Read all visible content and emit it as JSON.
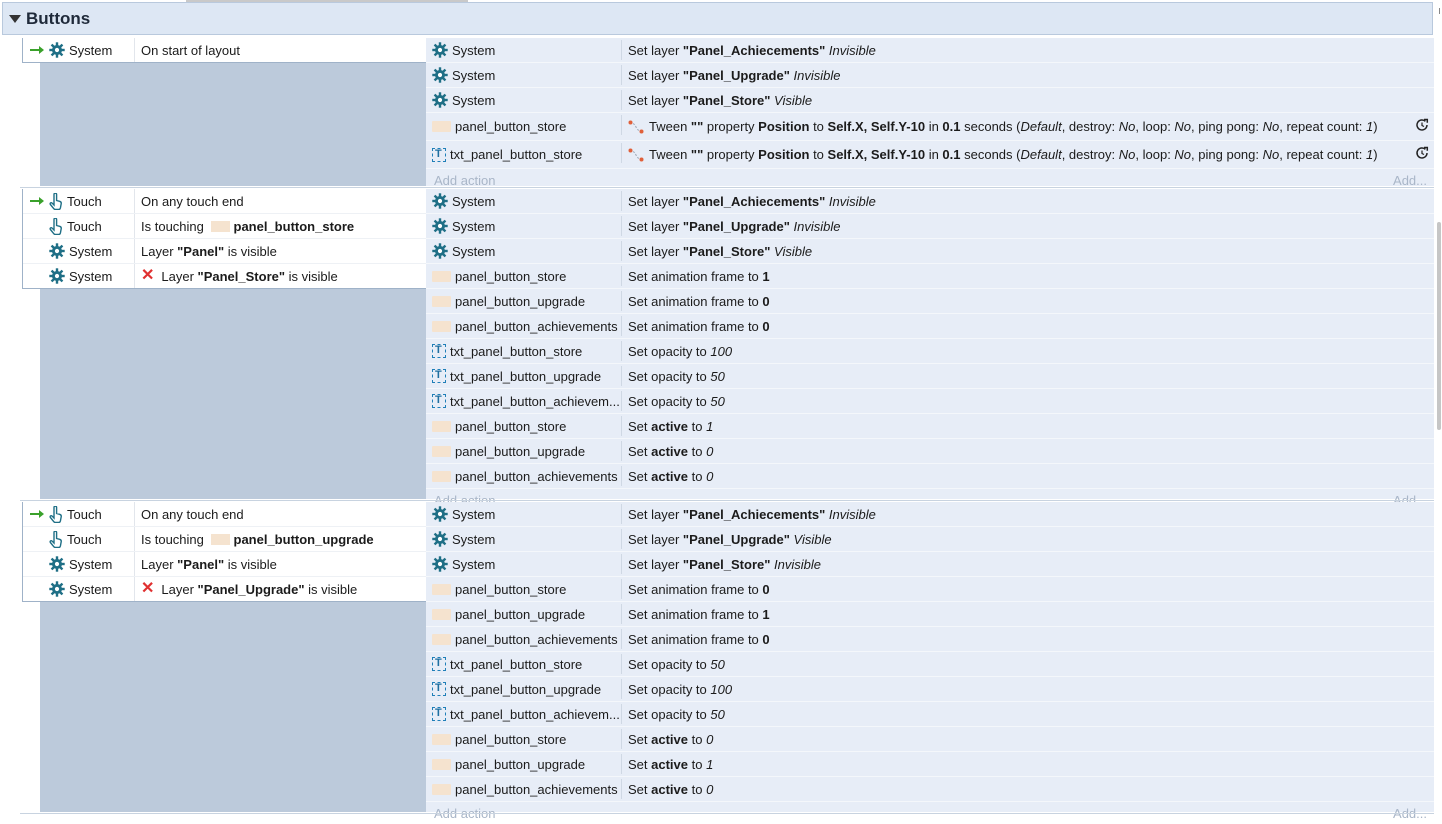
{
  "group": {
    "title": "Buttons"
  },
  "events": [
    {
      "conditions": [
        {
          "trigger": true,
          "icon": "gear-icon",
          "object": "System",
          "invert": false,
          "parts": [
            {
              "t": "On start of layout",
              "s": "n"
            }
          ]
        }
      ],
      "actions": [
        {
          "icon": "gear-icon",
          "object": "System",
          "parts": [
            {
              "t": "Set layer ",
              "s": "n"
            },
            {
              "t": "\"Panel_Achiecements\"",
              "s": "b"
            },
            {
              "t": " Invisible",
              "s": "i"
            }
          ]
        },
        {
          "icon": "gear-icon",
          "object": "System",
          "parts": [
            {
              "t": "Set layer ",
              "s": "n"
            },
            {
              "t": "\"Panel_Upgrade\"",
              "s": "b"
            },
            {
              "t": " Invisible",
              "s": "i"
            }
          ]
        },
        {
          "icon": "gear-icon",
          "object": "System",
          "parts": [
            {
              "t": "Set layer ",
              "s": "n"
            },
            {
              "t": "\"Panel_Store\"",
              "s": "b"
            },
            {
              "t": " Visible",
              "s": "i"
            }
          ]
        },
        {
          "icon": "sprite-icon",
          "object": "panel_button_store",
          "tween": true,
          "redo": true,
          "parts": [
            {
              "t": "Tween ",
              "s": "n"
            },
            {
              "t": "\"\"",
              "s": "b"
            },
            {
              "t": " property ",
              "s": "n"
            },
            {
              "t": "Position",
              "s": "b"
            },
            {
              "t": " to ",
              "s": "n"
            },
            {
              "t": "Self.X, Self.Y-10",
              "s": "b"
            },
            {
              "t": " in ",
              "s": "n"
            },
            {
              "t": "0.1",
              "s": "b"
            },
            {
              "t": " seconds (",
              "s": "n"
            },
            {
              "t": "Default",
              "s": "i"
            },
            {
              "t": ", destroy: ",
              "s": "n"
            },
            {
              "t": "No",
              "s": "i"
            },
            {
              "t": ", loop: ",
              "s": "n"
            },
            {
              "t": "No",
              "s": "i"
            },
            {
              "t": ", ping pong: ",
              "s": "n"
            },
            {
              "t": "No",
              "s": "i"
            },
            {
              "t": ", repeat count: ",
              "s": "n"
            },
            {
              "t": "1",
              "s": "i"
            },
            {
              "t": ")",
              "s": "n"
            }
          ]
        },
        {
          "icon": "text-object-icon",
          "object": "txt_panel_button_store",
          "tween": true,
          "redo": true,
          "parts": [
            {
              "t": "Tween ",
              "s": "n"
            },
            {
              "t": "\"\"",
              "s": "b"
            },
            {
              "t": " property ",
              "s": "n"
            },
            {
              "t": "Position",
              "s": "b"
            },
            {
              "t": " to ",
              "s": "n"
            },
            {
              "t": "Self.X, Self.Y-10",
              "s": "b"
            },
            {
              "t": " in ",
              "s": "n"
            },
            {
              "t": "0.1",
              "s": "b"
            },
            {
              "t": " seconds (",
              "s": "n"
            },
            {
              "t": "Default",
              "s": "i"
            },
            {
              "t": ", destroy: ",
              "s": "n"
            },
            {
              "t": "No",
              "s": "i"
            },
            {
              "t": ", loop: ",
              "s": "n"
            },
            {
              "t": "No",
              "s": "i"
            },
            {
              "t": ", ping pong: ",
              "s": "n"
            },
            {
              "t": "No",
              "s": "i"
            },
            {
              "t": ", repeat count: ",
              "s": "n"
            },
            {
              "t": "1",
              "s": "i"
            },
            {
              "t": ")",
              "s": "n"
            }
          ]
        }
      ],
      "add_action": "Add action",
      "add_more": "Add..."
    },
    {
      "conditions": [
        {
          "trigger": true,
          "icon": "touch-icon",
          "object": "Touch",
          "invert": false,
          "parts": [
            {
              "t": "On any touch end",
              "s": "n"
            }
          ]
        },
        {
          "trigger": false,
          "icon": "touch-icon",
          "object": "Touch",
          "invert": false,
          "sprite": true,
          "parts": [
            {
              "t": "Is touching ",
              "s": "n"
            },
            {
              "t": "SPRITE",
              "s": "sp"
            },
            {
              "t": "panel_button_store",
              "s": "b"
            }
          ]
        },
        {
          "trigger": false,
          "icon": "gear-icon",
          "object": "System",
          "invert": false,
          "parts": [
            {
              "t": "Layer ",
              "s": "n"
            },
            {
              "t": "\"Panel\"",
              "s": "b"
            },
            {
              "t": " is visible",
              "s": "n"
            }
          ]
        },
        {
          "trigger": false,
          "icon": "gear-icon",
          "object": "System",
          "invert": true,
          "parts": [
            {
              "t": "Layer ",
              "s": "n"
            },
            {
              "t": "\"Panel_Store\"",
              "s": "b"
            },
            {
              "t": " is visible",
              "s": "n"
            }
          ]
        }
      ],
      "actions": [
        {
          "icon": "gear-icon",
          "object": "System",
          "parts": [
            {
              "t": "Set layer ",
              "s": "n"
            },
            {
              "t": "\"Panel_Achiecements\"",
              "s": "b"
            },
            {
              "t": " Invisible",
              "s": "i"
            }
          ]
        },
        {
          "icon": "gear-icon",
          "object": "System",
          "parts": [
            {
              "t": "Set layer ",
              "s": "n"
            },
            {
              "t": "\"Panel_Upgrade\"",
              "s": "b"
            },
            {
              "t": " Invisible",
              "s": "i"
            }
          ]
        },
        {
          "icon": "gear-icon",
          "object": "System",
          "parts": [
            {
              "t": "Set layer ",
              "s": "n"
            },
            {
              "t": "\"Panel_Store\"",
              "s": "b"
            },
            {
              "t": " Visible",
              "s": "i"
            }
          ]
        },
        {
          "icon": "sprite-icon",
          "object": "panel_button_store",
          "parts": [
            {
              "t": "Set animation frame to ",
              "s": "n"
            },
            {
              "t": "1",
              "s": "b"
            }
          ]
        },
        {
          "icon": "sprite-icon",
          "object": "panel_button_upgrade",
          "parts": [
            {
              "t": "Set animation frame to ",
              "s": "n"
            },
            {
              "t": "0",
              "s": "b"
            }
          ]
        },
        {
          "icon": "sprite-icon",
          "object": "panel_button_achievements",
          "parts": [
            {
              "t": "Set animation frame to ",
              "s": "n"
            },
            {
              "t": "0",
              "s": "b"
            }
          ]
        },
        {
          "icon": "text-object-icon",
          "object": "txt_panel_button_store",
          "parts": [
            {
              "t": "Set opacity to ",
              "s": "n"
            },
            {
              "t": "100",
              "s": "i"
            }
          ]
        },
        {
          "icon": "text-object-icon",
          "object": "txt_panel_button_upgrade",
          "parts": [
            {
              "t": "Set opacity to ",
              "s": "n"
            },
            {
              "t": "50",
              "s": "i"
            }
          ]
        },
        {
          "icon": "text-object-icon",
          "object": "txt_panel_button_achievem...",
          "parts": [
            {
              "t": "Set opacity to ",
              "s": "n"
            },
            {
              "t": "50",
              "s": "i"
            }
          ]
        },
        {
          "icon": "sprite-icon",
          "object": "panel_button_store",
          "parts": [
            {
              "t": "Set ",
              "s": "n"
            },
            {
              "t": "active",
              "s": "b"
            },
            {
              "t": " to ",
              "s": "n"
            },
            {
              "t": "1",
              "s": "i"
            }
          ]
        },
        {
          "icon": "sprite-icon",
          "object": "panel_button_upgrade",
          "parts": [
            {
              "t": "Set ",
              "s": "n"
            },
            {
              "t": "active",
              "s": "b"
            },
            {
              "t": " to ",
              "s": "n"
            },
            {
              "t": "0",
              "s": "i"
            }
          ]
        },
        {
          "icon": "sprite-icon",
          "object": "panel_button_achievements",
          "parts": [
            {
              "t": "Set ",
              "s": "n"
            },
            {
              "t": "active",
              "s": "b"
            },
            {
              "t": " to ",
              "s": "n"
            },
            {
              "t": "0",
              "s": "i"
            }
          ]
        }
      ],
      "add_action": "Add action",
      "add_more": "Add..."
    },
    {
      "conditions": [
        {
          "trigger": true,
          "icon": "touch-icon",
          "object": "Touch",
          "invert": false,
          "parts": [
            {
              "t": "On any touch end",
              "s": "n"
            }
          ]
        },
        {
          "trigger": false,
          "icon": "touch-icon",
          "object": "Touch",
          "invert": false,
          "sprite": true,
          "parts": [
            {
              "t": "Is touching ",
              "s": "n"
            },
            {
              "t": "SPRITE",
              "s": "sp"
            },
            {
              "t": "panel_button_upgrade",
              "s": "b"
            }
          ]
        },
        {
          "trigger": false,
          "icon": "gear-icon",
          "object": "System",
          "invert": false,
          "parts": [
            {
              "t": "Layer ",
              "s": "n"
            },
            {
              "t": "\"Panel\"",
              "s": "b"
            },
            {
              "t": " is visible",
              "s": "n"
            }
          ]
        },
        {
          "trigger": false,
          "icon": "gear-icon",
          "object": "System",
          "invert": true,
          "parts": [
            {
              "t": "Layer ",
              "s": "n"
            },
            {
              "t": "\"Panel_Upgrade\"",
              "s": "b"
            },
            {
              "t": " is visible",
              "s": "n"
            }
          ]
        }
      ],
      "actions": [
        {
          "icon": "gear-icon",
          "object": "System",
          "parts": [
            {
              "t": "Set layer ",
              "s": "n"
            },
            {
              "t": "\"Panel_Achiecements\"",
              "s": "b"
            },
            {
              "t": " Invisible",
              "s": "i"
            }
          ]
        },
        {
          "icon": "gear-icon",
          "object": "System",
          "parts": [
            {
              "t": "Set layer ",
              "s": "n"
            },
            {
              "t": "\"Panel_Upgrade\"",
              "s": "b"
            },
            {
              "t": " Visible",
              "s": "i"
            }
          ]
        },
        {
          "icon": "gear-icon",
          "object": "System",
          "parts": [
            {
              "t": "Set layer ",
              "s": "n"
            },
            {
              "t": "\"Panel_Store\"",
              "s": "b"
            },
            {
              "t": " Invisible",
              "s": "i"
            }
          ]
        },
        {
          "icon": "sprite-icon",
          "object": "panel_button_store",
          "parts": [
            {
              "t": "Set animation frame to ",
              "s": "n"
            },
            {
              "t": "0",
              "s": "b"
            }
          ]
        },
        {
          "icon": "sprite-icon",
          "object": "panel_button_upgrade",
          "parts": [
            {
              "t": "Set animation frame to ",
              "s": "n"
            },
            {
              "t": "1",
              "s": "b"
            }
          ]
        },
        {
          "icon": "sprite-icon",
          "object": "panel_button_achievements",
          "parts": [
            {
              "t": "Set animation frame to ",
              "s": "n"
            },
            {
              "t": "0",
              "s": "b"
            }
          ]
        },
        {
          "icon": "text-object-icon",
          "object": "txt_panel_button_store",
          "parts": [
            {
              "t": "Set opacity to ",
              "s": "n"
            },
            {
              "t": "50",
              "s": "i"
            }
          ]
        },
        {
          "icon": "text-object-icon",
          "object": "txt_panel_button_upgrade",
          "parts": [
            {
              "t": "Set opacity to ",
              "s": "n"
            },
            {
              "t": "100",
              "s": "i"
            }
          ]
        },
        {
          "icon": "text-object-icon",
          "object": "txt_panel_button_achievem...",
          "parts": [
            {
              "t": "Set opacity to ",
              "s": "n"
            },
            {
              "t": "50",
              "s": "i"
            }
          ]
        },
        {
          "icon": "sprite-icon",
          "object": "panel_button_store",
          "parts": [
            {
              "t": "Set ",
              "s": "n"
            },
            {
              "t": "active",
              "s": "b"
            },
            {
              "t": " to ",
              "s": "n"
            },
            {
              "t": "0",
              "s": "i"
            }
          ]
        },
        {
          "icon": "sprite-icon",
          "object": "panel_button_upgrade",
          "parts": [
            {
              "t": "Set ",
              "s": "n"
            },
            {
              "t": "active",
              "s": "b"
            },
            {
              "t": " to ",
              "s": "n"
            },
            {
              "t": "1",
              "s": "i"
            }
          ]
        },
        {
          "icon": "sprite-icon",
          "object": "panel_button_achievements",
          "parts": [
            {
              "t": "Set ",
              "s": "n"
            },
            {
              "t": "active",
              "s": "b"
            },
            {
              "t": " to ",
              "s": "n"
            },
            {
              "t": "0",
              "s": "i"
            }
          ]
        }
      ],
      "add_action": "Add action",
      "add_more": "Add..."
    }
  ],
  "colors": {
    "gear": "#1f6f86",
    "touch": "#1f6f86",
    "trigger": "#3aa12b",
    "invert": "#e03030",
    "tween": "#e0603a"
  }
}
